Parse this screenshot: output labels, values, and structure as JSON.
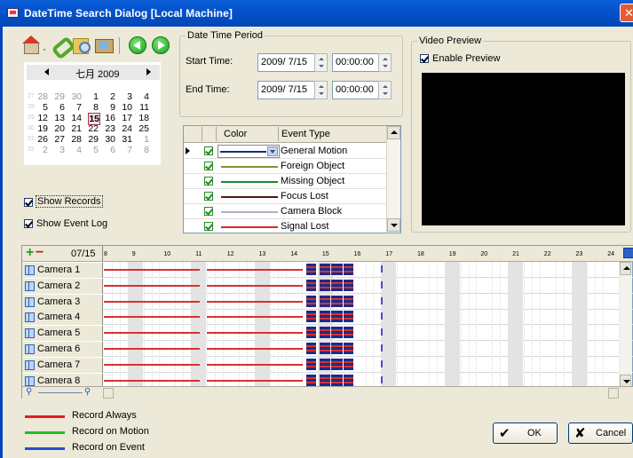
{
  "window": {
    "title": "DateTime Search Dialog  [Local Machine]",
    "close": "✕"
  },
  "toolbar": {
    "separator_dot": "·"
  },
  "calendar": {
    "month_label": "七月 2009",
    "weeks": [
      {
        "wk": "27",
        "days": [
          {
            "d": "28",
            "grey": true
          },
          {
            "d": "29",
            "grey": true
          },
          {
            "d": "30",
            "grey": true
          },
          {
            "d": "1"
          },
          {
            "d": "2"
          },
          {
            "d": "3"
          },
          {
            "d": "4"
          }
        ]
      },
      {
        "wk": "28",
        "days": [
          {
            "d": "5"
          },
          {
            "d": "6"
          },
          {
            "d": "7"
          },
          {
            "d": "8"
          },
          {
            "d": "9"
          },
          {
            "d": "10"
          },
          {
            "d": "11"
          }
        ]
      },
      {
        "wk": "29",
        "days": [
          {
            "d": "12"
          },
          {
            "d": "13"
          },
          {
            "d": "14"
          },
          {
            "d": "15",
            "selected": true
          },
          {
            "d": "16"
          },
          {
            "d": "17"
          },
          {
            "d": "18"
          }
        ]
      },
      {
        "wk": "30",
        "days": [
          {
            "d": "19"
          },
          {
            "d": "20"
          },
          {
            "d": "21"
          },
          {
            "d": "22"
          },
          {
            "d": "23"
          },
          {
            "d": "24"
          },
          {
            "d": "25"
          }
        ]
      },
      {
        "wk": "31",
        "days": [
          {
            "d": "26"
          },
          {
            "d": "27"
          },
          {
            "d": "28"
          },
          {
            "d": "29"
          },
          {
            "d": "30"
          },
          {
            "d": "31"
          },
          {
            "d": "1",
            "grey": true
          }
        ]
      },
      {
        "wk": "32",
        "days": [
          {
            "d": "2",
            "grey": true
          },
          {
            "d": "3",
            "grey": true
          },
          {
            "d": "4",
            "grey": true
          },
          {
            "d": "5",
            "grey": true
          },
          {
            "d": "6",
            "grey": true
          },
          {
            "d": "7",
            "grey": true
          },
          {
            "d": "8",
            "grey": true
          }
        ]
      }
    ]
  },
  "options": {
    "show_records": "Show Records",
    "show_event_log": "Show Event Log",
    "show_records_checked": true,
    "show_event_log_checked": true
  },
  "period": {
    "title": "Date Time Period",
    "start_label": "Start Time:",
    "start_date": "2009/ 7/15",
    "start_time": "00:00:00",
    "end_label": "End Time:",
    "end_date": "2009/ 7/15",
    "end_time": "00:00:00"
  },
  "events": {
    "col_color": "Color",
    "col_type": "Event Type",
    "rows": [
      {
        "type": "General Motion",
        "color": "#1c2a6e",
        "checked": true
      },
      {
        "type": "Foreign Object",
        "color": "#8b8b3a",
        "checked": true
      },
      {
        "type": "Missing Object",
        "color": "#1d8a2a",
        "checked": true
      },
      {
        "type": "Focus Lost",
        "color": "#4a1a12",
        "checked": true
      },
      {
        "type": "Camera Block",
        "color": "#a9b4c4",
        "checked": true
      },
      {
        "type": "Signal Lost",
        "color": "#d42a2a",
        "checked": true
      }
    ]
  },
  "preview": {
    "title": "Video Preview",
    "enable_label": "Enable Preview",
    "enabled": true
  },
  "timeline": {
    "date": "07/15",
    "hours": [
      "8",
      "9",
      "10",
      "11",
      "12",
      "13",
      "14",
      "15",
      "16",
      "17",
      "18",
      "19",
      "20",
      "21",
      "22",
      "23",
      "24"
    ],
    "cameras": [
      "Camera 1",
      "Camera 2",
      "Camera 3",
      "Camera 4",
      "Camera 5",
      "Camera 6",
      "Camera 7",
      "Camera 8"
    ],
    "record_color": "#d83030",
    "event_color": "#1c2a8a"
  },
  "legend": [
    {
      "label": "Record Always",
      "color": "#e02020"
    },
    {
      "label": "Record on Motion",
      "color": "#20c020"
    },
    {
      "label": "Record on Event",
      "color": "#2050d0"
    }
  ],
  "buttons": {
    "ok": "OK",
    "cancel": "Cancel",
    "ok_icon": "✔",
    "cancel_icon": "✘"
  }
}
